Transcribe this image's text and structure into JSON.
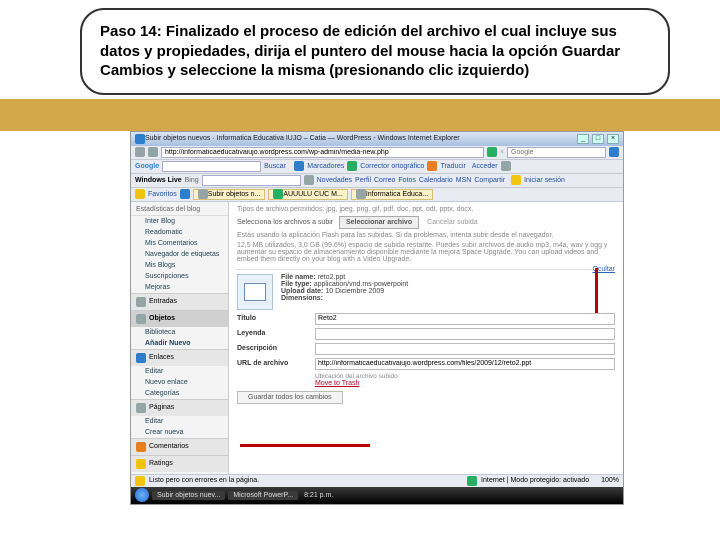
{
  "instruction": "Paso 14: Finalizado el proceso de edición del archivo el cual incluye sus datos y propiedades, dirija el puntero del mouse hacia la opción Guardar Cambios y seleccione la misma (presionando clic izquierdo)",
  "window_title": "Subir objetos nuevos · Informatica Educativa IUJO – Catia — WordPress - Windows Internet Explorer",
  "url": "http://informaticaeducativaiujo.wordpress.com/wp-admin/media-new.php",
  "search_placeholder": "Google",
  "toolbar_links": [
    "Buscar",
    "Novedades",
    "Perfil",
    "Correo",
    "Fotos",
    "Calendario",
    "MSN",
    "Compartir"
  ],
  "toolbar_right": "Iniciar sesión",
  "providers": [
    "Windows Live",
    "Bing"
  ],
  "marcadores": "Marcadores",
  "corrector": "Corrector ortográfico",
  "traducir_label": "Traducir",
  "acceder_label": "Acceder",
  "favorites_label": "Favoritos",
  "tabs": [
    "Subir objetos n...",
    "AUUULU CUC M...",
    "Informatica Educa..."
  ],
  "sidebar": {
    "blog_sec": "Estadísticas del blog",
    "items1": [
      "Inter Blog",
      "Readomatic",
      "Mis Comentarios",
      "Navegador de etiquetas",
      "Mis Blogs",
      "Suscripciones",
      "Mejoras"
    ],
    "entradas": "Entradas",
    "objetos": "Objetos",
    "biblioteca": "Biblioteca",
    "anadir": "Añadir Nuevo",
    "enlaces": "Enlaces",
    "items2": [
      "Editar",
      "Nuevo enlace",
      "Categorías"
    ],
    "paginas": "Páginas",
    "items3": [
      "Editar",
      "Crear nueva"
    ],
    "comentarios": "Comentarios",
    "ratings": "Ratings"
  },
  "main": {
    "hint": "Tipos de archivo permitidos: jpg, jpeg, png, gif, pdf, doc, ppt, odt, pptx, docx.",
    "sel_label": "Selecciona los archivos a subir",
    "sel_btn": "Seleccionar archivo",
    "cancel_btn": "Cancelar subida",
    "flash_msg": "Estás usando la aplicación Flash para las subidas. Si da problemas, intenta subir desde el navegador.",
    "quota": "12,5 MB utilizados, 3,0 GB (99.6%) espacio de subida restante. Puedes subir archivos de audio mp3, m4a, wav y ogg y aumentar su espacio de almacenamiento disponible mediante la mejora Space Upgrade. You can upload videos and embed them directly on your blog with a Video Upgrade.",
    "hide": "Ocultar",
    "file_name_label": "File name:",
    "file_name": "reto2.ppt",
    "file_type_label": "File type:",
    "file_type": "application/vnd.ms-powerpoint",
    "upload_date_label": "Upload date:",
    "upload_date": "10 Diciembre 2009",
    "dimensions_label": "Dimensions:",
    "titulo_label": "Título",
    "titulo_val": "Reto2",
    "leyenda_label": "Leyenda",
    "descripcion_label": "Descripción",
    "url_label": "URL de archivo",
    "url_val": "http://informaticaeducativaiujo.wordpress.com/files/2009/12/reto2.ppt",
    "ubicacion": "Ubicación del archivo subido",
    "trash": "Move to Trash",
    "save_btn": "Guardar todos los cambios"
  },
  "status": {
    "left": "Listo pero con errores en la página.",
    "mode": "Internet | Modo protegido: activado",
    "zoom": "100%"
  },
  "taskbar": {
    "btn1": "Subir objetos nuev...",
    "btn2": "Microsoft PowerP...",
    "time": "8:21 p.m."
  }
}
